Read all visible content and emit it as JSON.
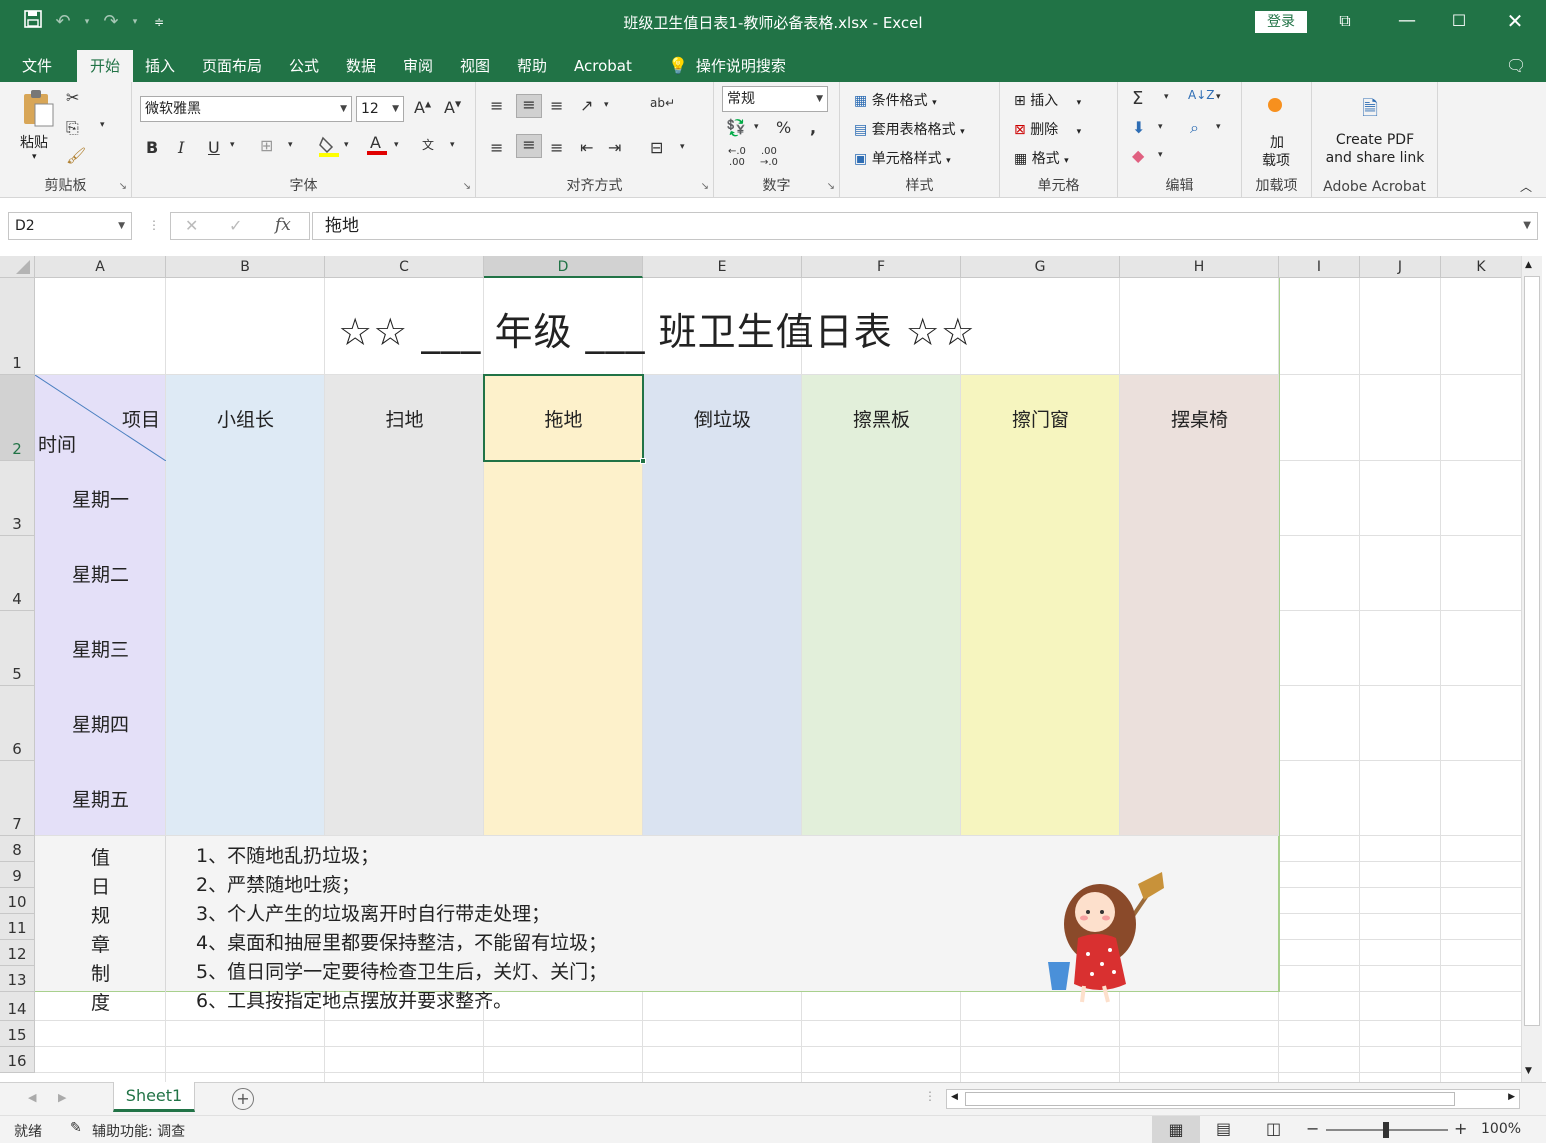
{
  "titlebar": {
    "title": "班级卫生值日表1-教师必备表格.xlsx  -  Excel",
    "login": "登录",
    "accent_color": "#217346"
  },
  "ribbon_tabs": [
    "文件",
    "开始",
    "插入",
    "页面布局",
    "公式",
    "数据",
    "审阅",
    "视图",
    "帮助",
    "Acrobat"
  ],
  "tell_me": "操作说明搜索",
  "ribbon": {
    "clipboard": {
      "paste": "粘贴",
      "label": "剪贴板"
    },
    "font": {
      "name": "微软雅黑",
      "size": "12",
      "label": "字体"
    },
    "alignment": {
      "label": "对齐方式"
    },
    "number": {
      "format": "常规",
      "label": "数字"
    },
    "styles": {
      "cond": "条件格式",
      "table": "套用表格格式",
      "cell": "单元格样式",
      "label": "样式"
    },
    "cells": {
      "insert": "插入",
      "delete": "删除",
      "format": "格式",
      "label": "单元格"
    },
    "editing": {
      "label": "编辑"
    },
    "addins": {
      "line1": "加",
      "line2": "载项",
      "label": "加载项"
    },
    "acrobat": {
      "line1": "Create PDF",
      "line2": "and share link",
      "label": "Adobe Acrobat"
    }
  },
  "formula_bar": {
    "name_box": "D2",
    "content": "拖地"
  },
  "columns": [
    "A",
    "B",
    "C",
    "D",
    "E",
    "F",
    "G",
    "H",
    "I",
    "J",
    "K"
  ],
  "rows": [
    "1",
    "2",
    "3",
    "4",
    "5",
    "6",
    "7",
    "8",
    "9",
    "10",
    "11",
    "12",
    "13",
    "14",
    "15",
    "16"
  ],
  "sheet": {
    "title": "☆☆  ___ 年级 ___ 班卫生值日表 ☆☆",
    "corner_top": "项目",
    "corner_bottom": "时间",
    "headers": [
      "小组长",
      "扫地",
      "拖地",
      "倒垃圾",
      "擦黑板",
      "擦门窗",
      "摆桌椅"
    ],
    "days": [
      "星期一",
      "星期二",
      "星期三",
      "星期四",
      "星期五"
    ],
    "rules_label": [
      "值",
      "日",
      "规",
      "章",
      "制",
      "度"
    ],
    "rules": [
      "1、不随地乱扔垃圾；",
      "2、严禁随地吐痰；",
      "3、个人产生的垃圾离开时自行带走处理；",
      "4、桌面和抽屉里都要保持整洁，不能留有垃圾；",
      "5、值日同学一定要待检查卫生后，关灯、关门；",
      "6、工具按指定地点摆放并要求整齐。"
    ],
    "column_colors": [
      "#e4e0f8",
      "#deeaf5",
      "#e7e7e7",
      "#fdf1cb",
      "#dae3f1",
      "#e2efda",
      "#f6f5bf",
      "#ebe0dc"
    ]
  },
  "sheet_tab": "Sheet1",
  "status": {
    "ready": "就绪",
    "accessibility": "辅助功能: 调查",
    "zoom": "100%"
  }
}
